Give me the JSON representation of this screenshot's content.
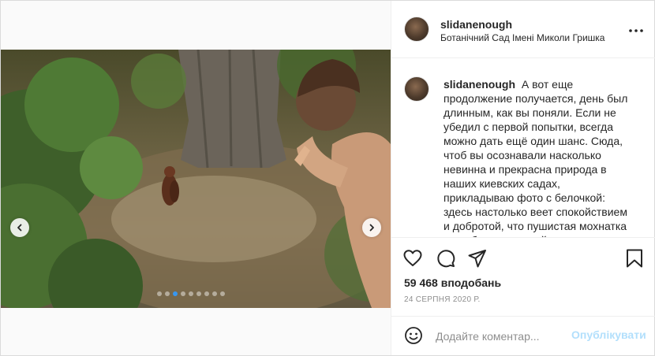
{
  "post": {
    "username": "slidanenough",
    "location": "Ботанічний Сад Імені Миколи Гришка",
    "more_icon": "more-dots-icon"
  },
  "media": {
    "current_slide": 3,
    "slide_count": 9,
    "prev_icon": "chevron-left-icon",
    "next_icon": "chevron-right-icon"
  },
  "caption": {
    "username": "slidanenough",
    "text": "А вот еще продолжение получается, день был длинным, как вы поняли. Если не убедил с первой попытки, всегда можно дать ещё один шанс. Сюда, чтоб вы осознавали насколько невинна и прекрасна природа в наших киевских садах, прикладываю фото с белочкой: здесь настолько веет спокойствием и добротой, что пушистая мохнатка не побоялась подойти и позировать"
  },
  "actions": {
    "like_icon": "heart-icon",
    "comment_icon": "comment-bubble-icon",
    "share_icon": "paper-plane-icon",
    "save_icon": "bookmark-icon"
  },
  "likes": "59 468 вподобань",
  "date": "24 СЕРПНЯ 2020 Р.",
  "composer": {
    "emoji_icon": "smiley-icon",
    "placeholder": "Додайте коментар...",
    "post_label": "Опублікувати"
  }
}
